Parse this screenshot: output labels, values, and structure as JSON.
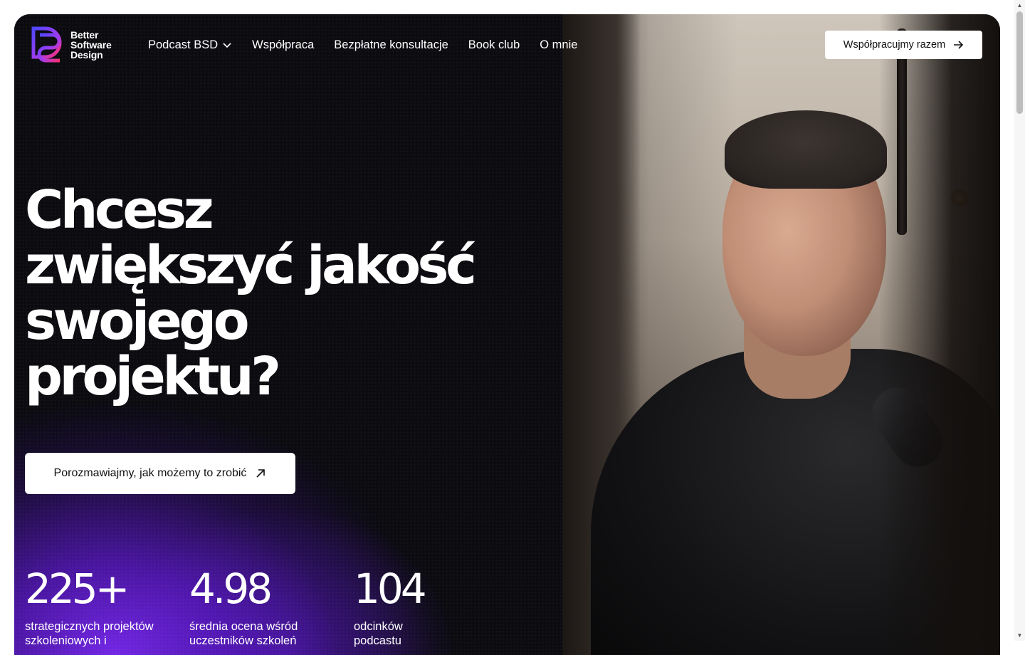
{
  "brand": {
    "name_line1": "Better",
    "name_line2": "Software",
    "name_line3": "Design",
    "gradient_start": "#5b3cf5",
    "gradient_end": "#f0287a"
  },
  "nav": {
    "items": [
      {
        "label": "Podcast BSD",
        "has_dropdown": true,
        "icon": "chevron-down-icon"
      },
      {
        "label": "Współpraca"
      },
      {
        "label": "Bezpłatne konsultacje"
      },
      {
        "label": "Book club"
      },
      {
        "label": "O mnie"
      }
    ],
    "cta_label": "Współpracujmy razem",
    "cta_icon": "arrow-right-icon"
  },
  "hero": {
    "headline_line1": "Chcesz",
    "headline_line2": "zwiększyć jakość",
    "headline_line3": "swojego",
    "headline_line4": "projektu?",
    "cta_label": "Porozmawiajmy, jak możemy to zrobić",
    "cta_icon": "arrow-up-right-icon",
    "accent_color": "#7a28f0"
  },
  "stats": [
    {
      "value": "225+",
      "label": "strategicznych projektów szkoleniowych i"
    },
    {
      "value": "4.98",
      "label": "średnia ocena wśród uczestników szkoleń"
    },
    {
      "value": "104",
      "label": "odcinków podcastu"
    }
  ]
}
